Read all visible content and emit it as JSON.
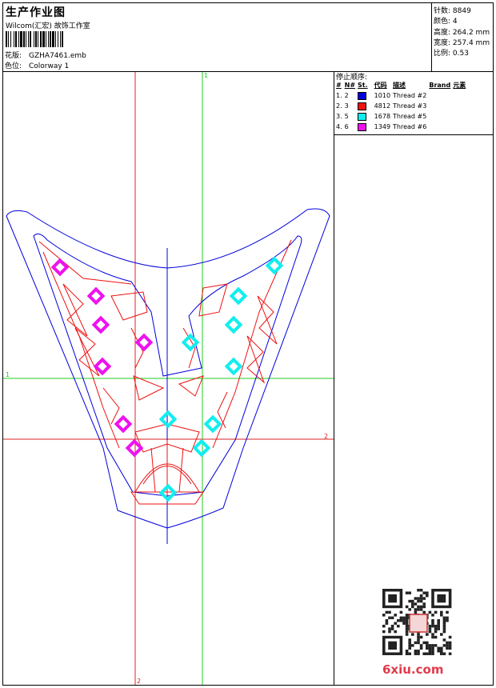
{
  "header": {
    "title": "生产作业图",
    "subtitle": "Wilcom(汇宏) 故饰工作室",
    "design_label": "花版:",
    "design_value": "GZHA7461.emb",
    "colorway_label": "色位:",
    "colorway_value": "Colorway 1"
  },
  "stats": [
    {
      "label": "针数:",
      "value": "8849"
    },
    {
      "label": "颜色:",
      "value": "4"
    },
    {
      "label": "高度:",
      "value": "264.2 mm"
    },
    {
      "label": "宽度:",
      "value": "257.4 mm"
    },
    {
      "label": "比例:",
      "value": "0.53"
    }
  ],
  "stop_sequence": {
    "title": "停止顺序:",
    "columns": [
      "#",
      "N#",
      "St.",
      "代码",
      "描述",
      "Brand",
      "元素"
    ],
    "rows": [
      {
        "num": "1.",
        "n": "2",
        "color": "#0000dd",
        "code": "1010",
        "desc": "Thread #2"
      },
      {
        "num": "2.",
        "n": "3",
        "color": "#ee1111",
        "code": "4812",
        "desc": "Thread #3"
      },
      {
        "num": "3.",
        "n": "5",
        "color": "#11eeee",
        "code": "1678",
        "desc": "Thread #5"
      },
      {
        "num": "4.",
        "n": "6",
        "color": "#ee11ee",
        "code": "1349",
        "desc": "Thread #6"
      }
    ]
  },
  "guides": {
    "green_v": "1",
    "green_h": "1",
    "red_h": "2",
    "red_v": "2"
  },
  "colors": {
    "outline": "#0000dd",
    "detail": "#ee1111",
    "cyan": "#11eeee",
    "magenta": "#ee11ee",
    "green_guide": "#22cc22",
    "red_guide": "#dd2222"
  },
  "watermark": {
    "text": "6xiu.com"
  }
}
